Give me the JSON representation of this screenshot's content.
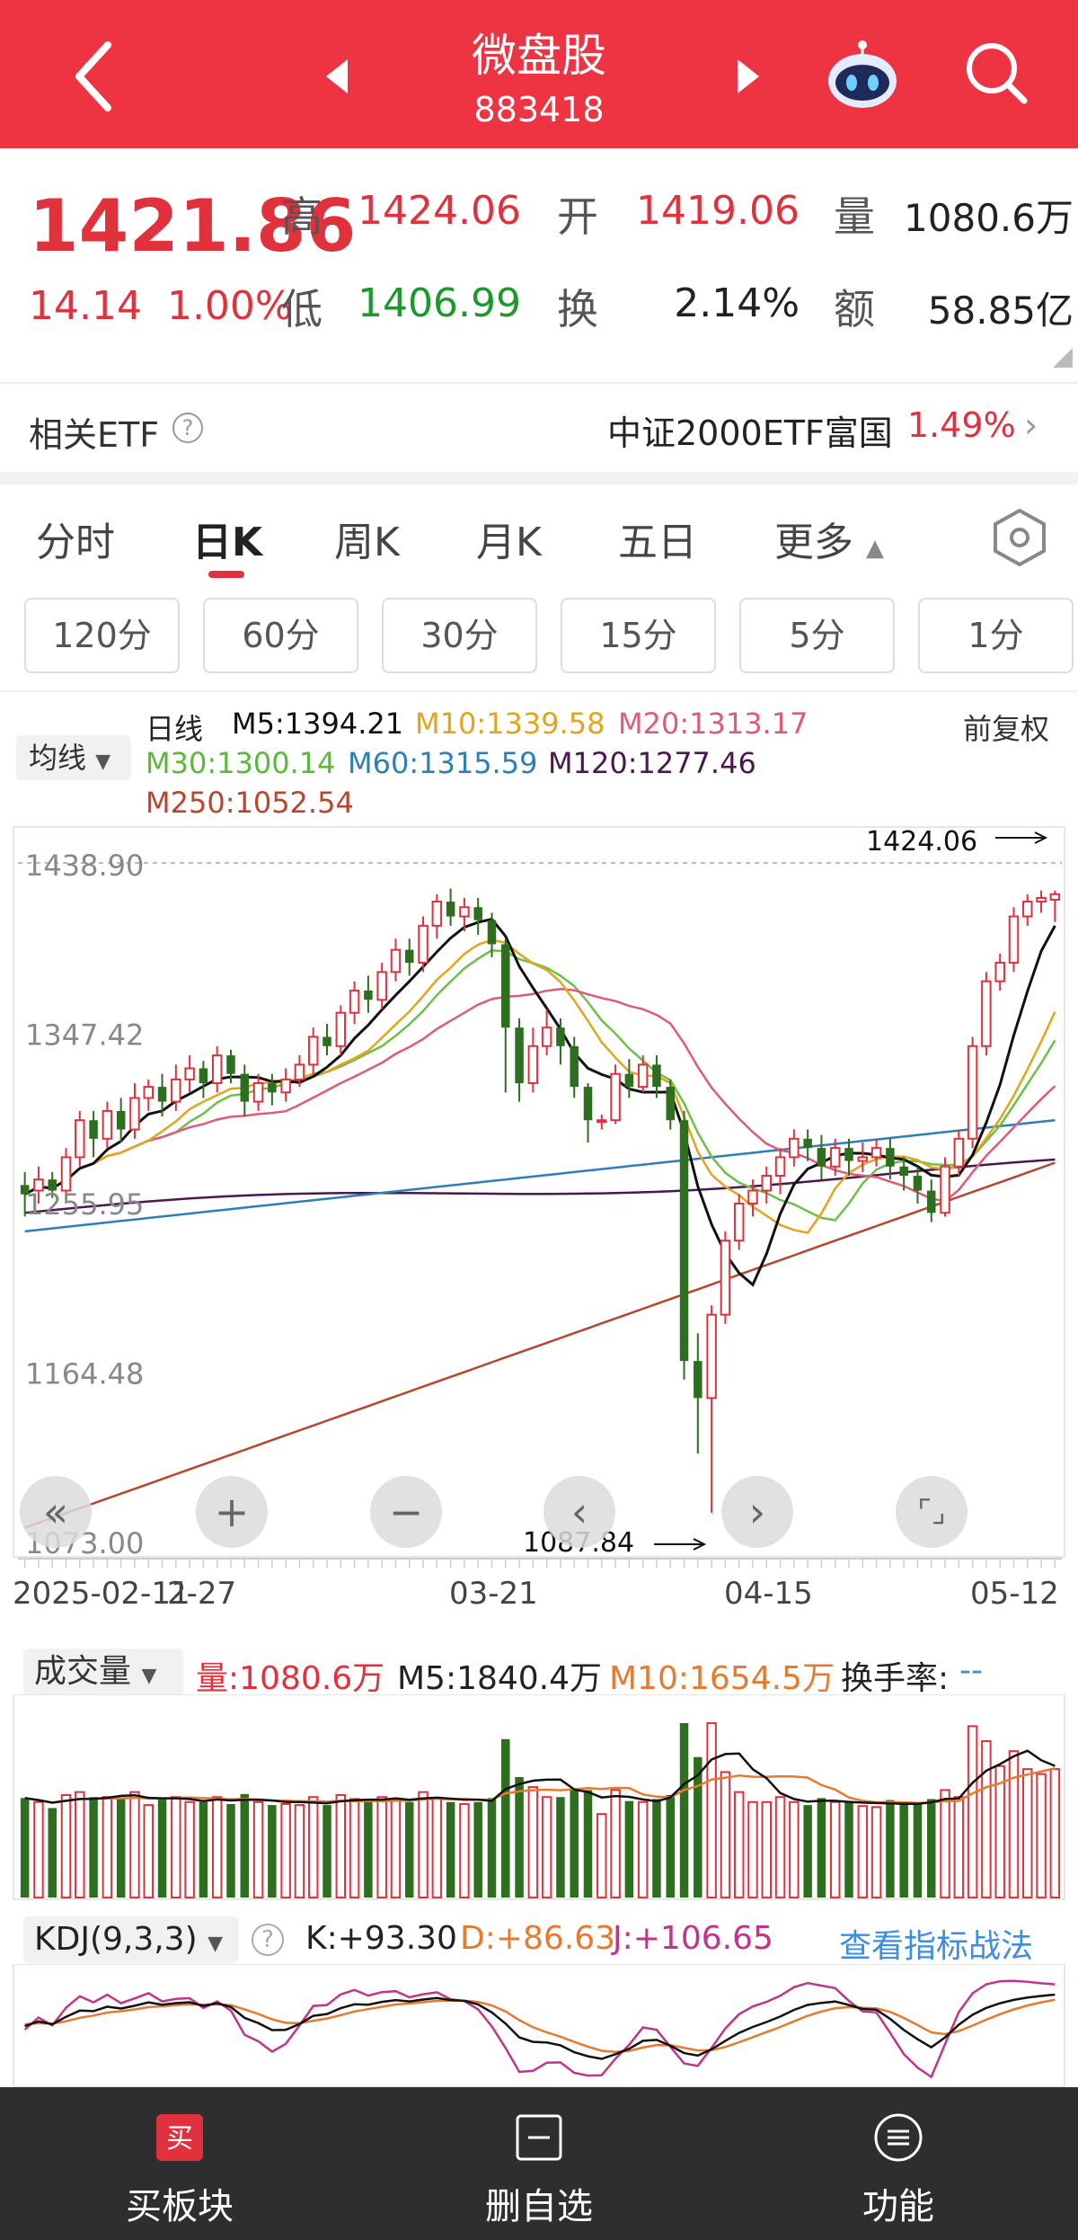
{
  "header": {
    "title": "微盘股",
    "code": "883418"
  },
  "quote": {
    "price": "1421.86",
    "change": "14.14",
    "change_pct": "1.00%",
    "high_label": "高",
    "high": "1424.06",
    "open_label": "开",
    "open": "1419.06",
    "volume_label": "量",
    "volume": "1080.6万",
    "low_label": "低",
    "low": "1406.99",
    "turnover_label": "换",
    "turnover": "2.14%",
    "amount_label": "额",
    "amount": "58.85亿"
  },
  "etf": {
    "label": "相关ETF",
    "help": "?",
    "name": "中证2000ETF富国",
    "pct": "1.49%",
    "arrow": "›"
  },
  "tabs": [
    {
      "label": "分时"
    },
    {
      "label": "日K"
    },
    {
      "label": "周K"
    },
    {
      "label": "月K"
    },
    {
      "label": "五日"
    },
    {
      "label": "更多"
    }
  ],
  "minute_buttons": [
    "120分",
    "60分",
    "30分",
    "15分",
    "5分",
    "1分"
  ],
  "ma": {
    "selector": "均线",
    "day_line": "日线",
    "m5": "M5:1394.21",
    "m10": "M10:1339.58",
    "m20": "M20:1313.17",
    "m30": "M30:1300.14",
    "m60": "M60:1315.59",
    "m120": "M120:1277.46",
    "m250": "M250:1052.54",
    "fuquan": "前复权",
    "colors": {
      "m5": "#111111",
      "m10": "#e3a51b",
      "m20": "#e05a7a",
      "m30": "#6cc04a",
      "m60": "#2d7fb8",
      "m120": "#4a1750",
      "m250": "#b8452c"
    }
  },
  "chart_labels": {
    "y_ticks": [
      "1438.90",
      "1347.42",
      "1255.95",
      "1164.48",
      "1073.00"
    ],
    "x_ticks": [
      "2025-02-11",
      "2-27",
      "03-21",
      "04-15",
      "05-12"
    ],
    "high_marker": "1424.06",
    "low_marker": "1087.84"
  },
  "controls": {
    "fast_back": "«",
    "zoom_in": "+",
    "zoom_out": "−",
    "prev": "‹",
    "next": "›",
    "fullscreen": "⌜⌟"
  },
  "volume": {
    "selector": "成交量",
    "vol": "量:1080.6万",
    "m5": "M5:1840.4万",
    "m10": "M10:1654.5万",
    "turnover": "换手率:",
    "turnover_val": "--"
  },
  "kdj": {
    "selector": "KDJ(9,3,3)",
    "help": "?",
    "k": "K:+93.30",
    "d": "D:+86.63",
    "j": "J:+106.65",
    "link": "查看指标战法"
  },
  "chart_data": {
    "type": "candlestick",
    "y_range": [
      1073.0,
      1438.9
    ],
    "x_labels": [
      "2025-02-11",
      "2-27",
      "03-21",
      "04-15",
      "05-12"
    ],
    "candles": [
      [
        1265,
        1260,
        1272,
        1248
      ],
      [
        1262,
        1268,
        1275,
        1255
      ],
      [
        1268,
        1262,
        1272,
        1258
      ],
      [
        1262,
        1280,
        1285,
        1258
      ],
      [
        1280,
        1300,
        1305,
        1275
      ],
      [
        1300,
        1290,
        1305,
        1280
      ],
      [
        1290,
        1305,
        1310,
        1285
      ],
      [
        1305,
        1295,
        1312,
        1288
      ],
      [
        1295,
        1312,
        1320,
        1290
      ],
      [
        1312,
        1318,
        1322,
        1305
      ],
      [
        1318,
        1310,
        1325,
        1302
      ],
      [
        1310,
        1322,
        1330,
        1305
      ],
      [
        1322,
        1328,
        1335,
        1315
      ],
      [
        1328,
        1320,
        1332,
        1312
      ],
      [
        1320,
        1335,
        1340,
        1315
      ],
      [
        1335,
        1325,
        1338,
        1320
      ],
      [
        1325,
        1310,
        1330,
        1302
      ],
      [
        1310,
        1320,
        1325,
        1305
      ],
      [
        1320,
        1315,
        1325,
        1308
      ],
      [
        1315,
        1322,
        1328,
        1310
      ],
      [
        1322,
        1330,
        1335,
        1318
      ],
      [
        1330,
        1345,
        1350,
        1325
      ],
      [
        1345,
        1340,
        1352,
        1335
      ],
      [
        1340,
        1358,
        1362,
        1335
      ],
      [
        1358,
        1370,
        1375,
        1352
      ],
      [
        1370,
        1365,
        1378,
        1358
      ],
      [
        1365,
        1380,
        1385,
        1360
      ],
      [
        1380,
        1392,
        1398,
        1375
      ],
      [
        1392,
        1385,
        1398,
        1378
      ],
      [
        1385,
        1405,
        1410,
        1380
      ],
      [
        1405,
        1418,
        1422,
        1398
      ],
      [
        1418,
        1410,
        1425,
        1405
      ],
      [
        1410,
        1415,
        1420,
        1402
      ],
      [
        1415,
        1408,
        1420,
        1400
      ],
      [
        1408,
        1395,
        1412,
        1388
      ],
      [
        1395,
        1350,
        1398,
        1315
      ],
      [
        1350,
        1320,
        1355,
        1310
      ],
      [
        1320,
        1340,
        1350,
        1315
      ],
      [
        1340,
        1350,
        1360,
        1335
      ],
      [
        1350,
        1340,
        1355,
        1330
      ],
      [
        1340,
        1318,
        1345,
        1312
      ],
      [
        1318,
        1300,
        1320,
        1288
      ],
      [
        1300,
        1300,
        1303,
        1295
      ],
      [
        1300,
        1325,
        1330,
        1298
      ],
      [
        1325,
        1318,
        1333,
        1312
      ],
      [
        1318,
        1330,
        1335,
        1315
      ],
      [
        1330,
        1318,
        1335,
        1312
      ],
      [
        1318,
        1300,
        1322,
        1295
      ],
      [
        1300,
        1170,
        1305,
        1160
      ],
      [
        1170,
        1150,
        1185,
        1120
      ],
      [
        1150,
        1195,
        1200,
        1088
      ],
      [
        1195,
        1235,
        1240,
        1190
      ],
      [
        1235,
        1255,
        1260,
        1230
      ],
      [
        1255,
        1262,
        1268,
        1248
      ],
      [
        1262,
        1270,
        1275,
        1255
      ],
      [
        1270,
        1280,
        1285,
        1260
      ],
      [
        1280,
        1290,
        1295,
        1275
      ],
      [
        1290,
        1285,
        1295,
        1278
      ],
      [
        1285,
        1275,
        1292,
        1268
      ],
      [
        1275,
        1285,
        1290,
        1270
      ],
      [
        1285,
        1278,
        1290,
        1270
      ],
      [
        1278,
        1280,
        1288,
        1272
      ],
      [
        1280,
        1285,
        1290,
        1275
      ],
      [
        1285,
        1275,
        1290,
        1268
      ],
      [
        1275,
        1270,
        1280,
        1262
      ],
      [
        1270,
        1262,
        1275,
        1255
      ],
      [
        1262,
        1250,
        1268,
        1245
      ],
      [
        1250,
        1275,
        1280,
        1248
      ],
      [
        1275,
        1290,
        1295,
        1270
      ],
      [
        1290,
        1340,
        1345,
        1285
      ],
      [
        1340,
        1375,
        1380,
        1335
      ],
      [
        1375,
        1385,
        1390,
        1370
      ],
      [
        1385,
        1410,
        1415,
        1380
      ],
      [
        1410,
        1418,
        1422,
        1405
      ],
      [
        1418,
        1420,
        1424,
        1412
      ],
      [
        1419,
        1422,
        1424,
        1407
      ]
    ]
  }
}
